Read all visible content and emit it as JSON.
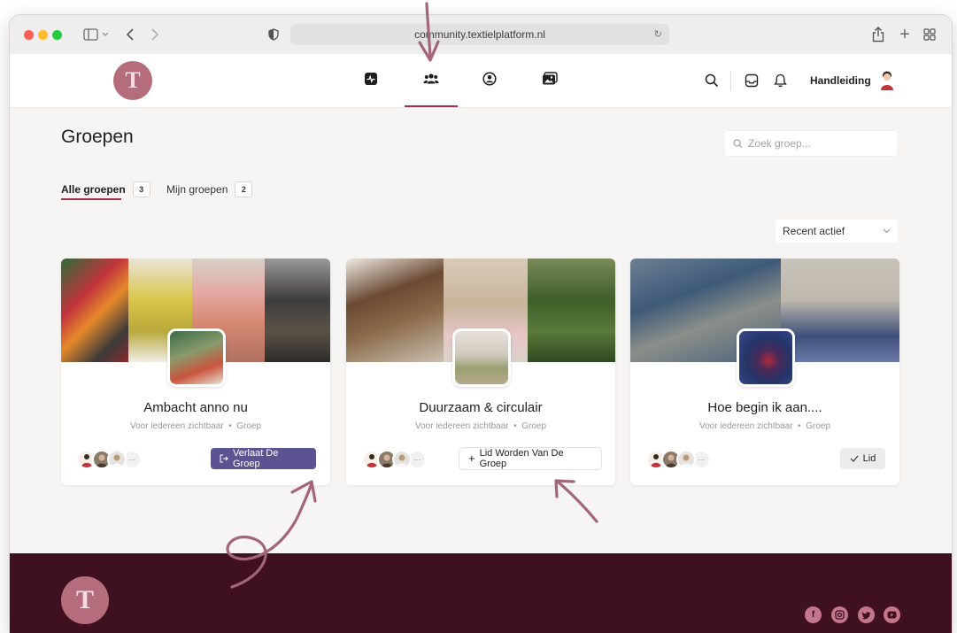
{
  "browser": {
    "url": "community.textielplatform.nl",
    "url_display": "community.textielplatform.nl"
  },
  "header": {
    "logo_letter": "T",
    "nav": [
      {
        "icon": "activity-icon"
      },
      {
        "icon": "groups-icon",
        "active": true
      },
      {
        "icon": "profile-icon"
      },
      {
        "icon": "photos-icon"
      }
    ],
    "manual_label": "Handleiding"
  },
  "page": {
    "title": "Groepen",
    "search_placeholder": "Zoek groep...",
    "tabs": [
      {
        "label": "Alle groepen",
        "count": "3",
        "active": true
      },
      {
        "label": "Mijn groepen",
        "count": "2"
      }
    ],
    "sort_label": "Recent actief"
  },
  "groups": [
    {
      "title": "Ambacht anno nu",
      "visibility": "Voor iedereen zichtbaar",
      "type": "Groep",
      "button_label": "Verlaat De Groep",
      "button_icon": "leave-icon"
    },
    {
      "title": "Duurzaam & circulair",
      "visibility": "Voor iedereen zichtbaar",
      "type": "Groep",
      "button_label": "Lid Worden Van De Groep",
      "button_icon": "plus-icon"
    },
    {
      "title": "Hoe begin ik aan....",
      "visibility": "Voor iedereen zichtbaar",
      "type": "Groep",
      "button_label": "Lid",
      "button_icon": "check-icon"
    }
  ],
  "colors": {
    "accent": "#a3334a",
    "primary_button": "#5c5492",
    "footer": "#3f1020",
    "logo": "#b56d7c",
    "annotation": "#a3657a"
  },
  "footer": {
    "logo_letter": "T",
    "social": [
      "facebook-icon",
      "instagram-icon",
      "twitter-icon",
      "youtube-icon"
    ]
  }
}
